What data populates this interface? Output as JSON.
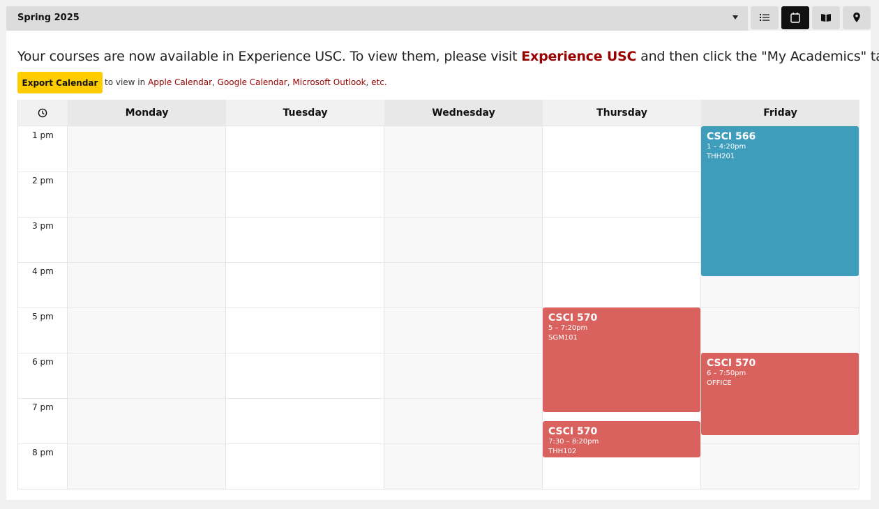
{
  "term_selector": {
    "value": "Spring 2025"
  },
  "view_buttons": [
    {
      "name": "list-view",
      "active": false
    },
    {
      "name": "calendar-view",
      "active": true
    },
    {
      "name": "catalog-view",
      "active": false
    },
    {
      "name": "map-view",
      "active": false
    }
  ],
  "notice": {
    "before": "Your courses are now available in Experience USC. To view them, please visit ",
    "link": "Experience USC",
    "after": " and then click the \"My Academics\" tab."
  },
  "export": {
    "button": "Export Calendar",
    "prefix": "to view in ",
    "apple": "Apple Calendar",
    "sep1": ", ",
    "google": "Google Calendar",
    "sep2": ", ",
    "outlook": "Microsoft Outlook",
    "sep3": ", ",
    "etc": "etc."
  },
  "calendar": {
    "days": [
      "Monday",
      "Tuesday",
      "Wednesday",
      "Thursday",
      "Friday"
    ],
    "hours": [
      "1 pm",
      "2 pm",
      "3 pm",
      "4 pm",
      "5 pm",
      "6 pm",
      "7 pm",
      "8 pm"
    ],
    "events": [
      {
        "day": "Friday",
        "code": "CSCI 566",
        "time": "1 – 4:20pm",
        "room": "THH201",
        "color": "#3d9dbb",
        "start": 13.0,
        "end": 16.33
      },
      {
        "day": "Thursday",
        "code": "CSCI 570",
        "time": "5 – 7:20pm",
        "room": "SGM101",
        "color": "#d9625f",
        "start": 17.0,
        "end": 19.33
      },
      {
        "day": "Friday",
        "code": "CSCI 570",
        "time": "6 – 7:50pm",
        "room": "OFFICE",
        "color": "#d9625f",
        "start": 18.0,
        "end": 19.83
      },
      {
        "day": "Thursday",
        "code": "CSCI 570",
        "time": "7:30 – 8:20pm",
        "room": "THH102",
        "color": "#d9625f",
        "start": 19.5,
        "end": 20.33
      }
    ]
  }
}
